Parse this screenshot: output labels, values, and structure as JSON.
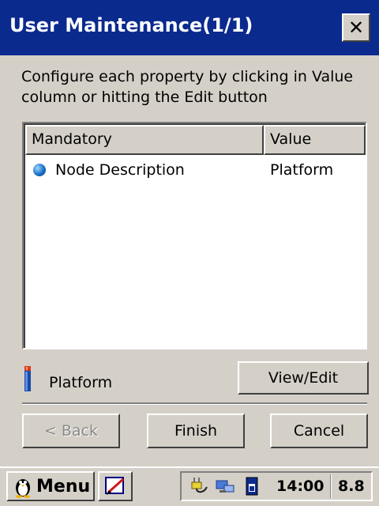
{
  "window": {
    "title": "User Maintenance(1/1)",
    "close_label": "✕"
  },
  "instructions": "Configure each property by clicking in Value column or hitting the Edit button",
  "list": {
    "columns": [
      "Mandatory",
      "Value"
    ],
    "rows": [
      {
        "icon": "blue-ball-icon",
        "property": "Node Description",
        "value": "Platform"
      }
    ]
  },
  "selection": {
    "icon": "pin-icon",
    "label": "Platform"
  },
  "buttons": {
    "view_edit": "View/Edit",
    "back": "< Back",
    "finish": "Finish",
    "cancel": "Cancel"
  },
  "taskbar": {
    "start_label": "Menu",
    "time": "14:00",
    "version": "8.8"
  },
  "colors": {
    "title_bar": "#0a2a8e",
    "face": "#d4d0c8"
  }
}
